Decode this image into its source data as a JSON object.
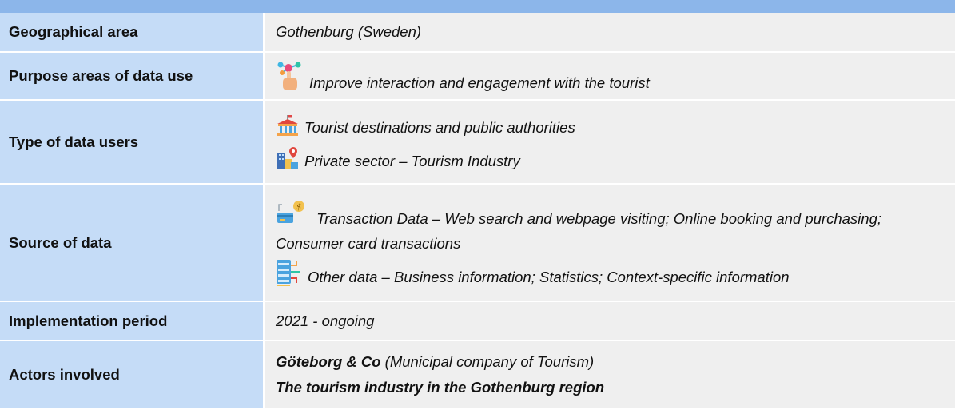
{
  "rows": {
    "geo": {
      "label": "Geographical area",
      "value": "Gothenburg (Sweden)"
    },
    "purpose": {
      "label": "Purpose areas of data use",
      "items": [
        {
          "icon": "hand-network-icon",
          "text": "Improve interaction and engagement with the tourist"
        }
      ]
    },
    "users": {
      "label": "Type of data users",
      "items": [
        {
          "icon": "government-building-icon",
          "text": "Tourist destinations and public authorities"
        },
        {
          "icon": "city-location-pin-icon",
          "text": "Private sector – Tourism Industry"
        }
      ]
    },
    "source": {
      "label": "Source of data",
      "items": [
        {
          "icon": "card-payment-icon",
          "text": "Transaction Data – Web search and webpage visiting; Online booking and purchasing; Consumer card transactions"
        },
        {
          "icon": "server-data-icon",
          "text": "Other data – Business information; Statistics; Context-specific information"
        }
      ]
    },
    "period": {
      "label": "Implementation period",
      "value": "2021 - ongoing"
    },
    "actors": {
      "label": "Actors involved",
      "actor1_name": "Göteborg & Co",
      "actor1_desc": " (Municipal company of Tourism)",
      "actor2": "The tourism industry in the Gothenburg region"
    }
  },
  "colors": {
    "header_bar": "#8cb6ea",
    "label_cell": "#c5dcf7",
    "value_cell": "#efefef"
  }
}
